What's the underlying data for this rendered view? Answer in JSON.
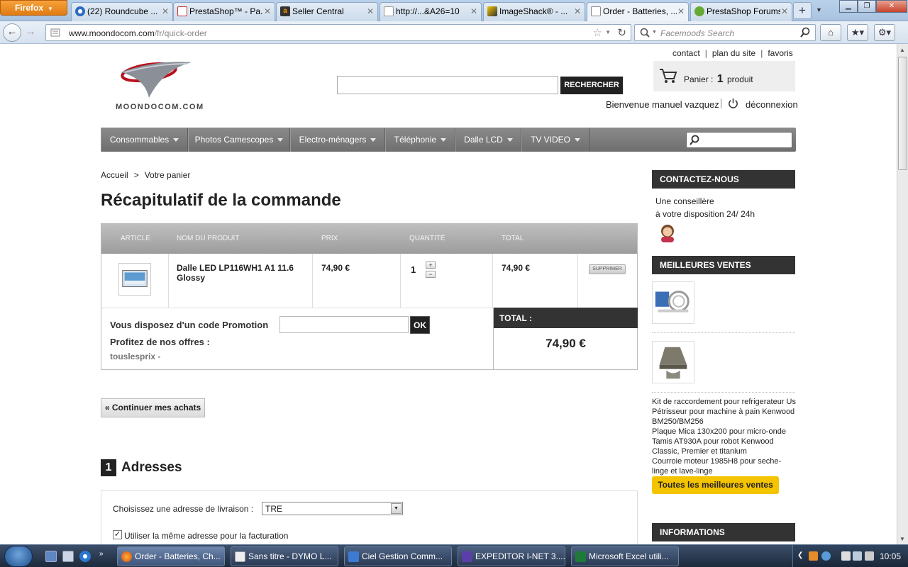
{
  "browser": {
    "app_button": "Firefox",
    "tabs": [
      {
        "label": "(22) Roundcube ...",
        "icon": "roundcube-icon",
        "active": false
      },
      {
        "label": "PrestaShop™ - Pa...",
        "icon": "prestashop-icon",
        "active": false
      },
      {
        "label": "Seller Central",
        "icon": "amazon-icon",
        "active": false
      },
      {
        "label": "http://...&A26=10",
        "icon": "page-icon",
        "active": false
      },
      {
        "label": "ImageShack® - ...",
        "icon": "imageshack-icon",
        "active": false
      },
      {
        "label": "Order - Batteries, ...",
        "icon": "moondocom-icon",
        "active": true
      },
      {
        "label": "PrestaShop Forums",
        "icon": "prestashop-forum-icon",
        "active": false
      }
    ],
    "new_tab": "+",
    "url_domain": "www.moondocom.com",
    "url_path": "/fr/quick-order",
    "search_placeholder": "Facemoods Search"
  },
  "header": {
    "top_links": [
      "contact",
      "plan du site",
      "favoris"
    ],
    "logo_text": "Moondocom.com",
    "search_button": "RECHERCHER",
    "cart_label": "Panier :",
    "cart_count": "1",
    "cart_unit": "produit",
    "welcome": "Bienvenue manuel vazquez",
    "logout": "déconnexion"
  },
  "menu": {
    "items": [
      "Consommables",
      "Photos Camescopes",
      "Electro-ménagers",
      "Téléphonie",
      "Dalle LCD",
      "TV VIDEO"
    ]
  },
  "breadcrumb": {
    "home": "Accueil",
    "separator": ">",
    "current": "Votre panier"
  },
  "page_title": "Récapitulatif de la commande",
  "cart": {
    "columns": [
      "Article",
      "Nom du produit",
      "Prix",
      "Quantité",
      "Total"
    ],
    "item": {
      "name": "Dalle LED LP116WH1 A1 11.6 Glossy",
      "price": "74,90 €",
      "quantity": "1",
      "total": "74,90 €",
      "delete": "Supprimer"
    },
    "promo_label": "Vous disposez d'un code Promotion",
    "promo_ok": "OK",
    "offers_label": "Profitez de nos offres :",
    "offers_value": "touslesprix -",
    "total_label": "TOTAL :",
    "total_value": "74,90 €"
  },
  "continue_button": "« Continuer mes achats",
  "addresses": {
    "step": "1",
    "title": "Adresses",
    "delivery_label": "Choisissez une adresse de livraison :",
    "delivery_value": "TRE",
    "same_billing_label": "Utiliser la même adresse pour la facturation",
    "same_billing_checked": true
  },
  "sidebar": {
    "contact_title": "CONTACTEZ-NOUS",
    "contact_line1": "Une conseillère",
    "contact_line2": "à votre disposition 24/ 24h",
    "best_title": "MEILLEURES VENTES",
    "best_items": [
      "Kit de raccordement pour refrigerateur Us",
      "Pétrisseur pour machine à pain Kenwood BM250/BM256",
      "Plaque Mica 130x200 pour micro-onde",
      "Tamis AT930A pour robot Kenwood Classic, Premier et titanium",
      "Courroie moteur 1985H8 pour seche-linge et lave-linge"
    ],
    "best_all_button": "Toutes les meilleures ventes",
    "info_title": "INFORMATIONS"
  },
  "taskbar": {
    "tasks": [
      {
        "label": "Order - Batteries, Ch...",
        "icon": "firefox-icon",
        "active": true
      },
      {
        "label": "Sans titre - DYMO L...",
        "icon": "dymo-icon",
        "active": false
      },
      {
        "label": "Ciel Gestion Comm...",
        "icon": "ciel-icon",
        "active": false
      },
      {
        "label": "EXPEDITOR I-NET 3....",
        "icon": "expeditor-icon",
        "active": false
      },
      {
        "label": "Microsoft Excel utili...",
        "icon": "excel-icon",
        "active": false
      }
    ],
    "clock": "10:05"
  },
  "colors": {
    "menu_bar": "#7a7a7a",
    "dark_header": "#333333",
    "accent_button": "#f5c400",
    "firefox_button": "#e8891f"
  }
}
